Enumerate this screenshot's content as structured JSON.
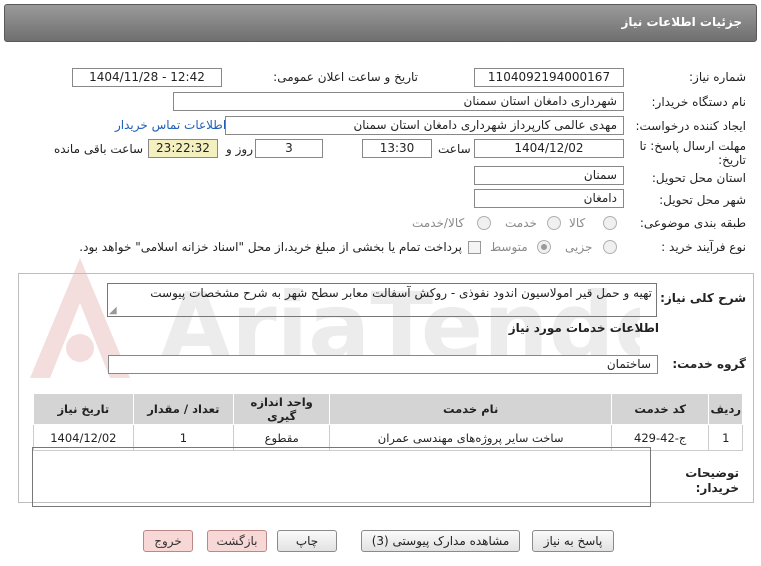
{
  "header": {
    "title": "جزئیات اطلاعات نیاز"
  },
  "form": {
    "need_number_label": "شماره نیاز:",
    "need_number": "1104092194000167",
    "announce_label": "تاریخ و ساعت اعلان عمومی:",
    "announce_value": "1404/11/28 - 12:42",
    "buyer_org_label": "نام دستگاه خریدار:",
    "buyer_org": "شهرداری دامغان استان سمنان",
    "creator_label": "ایجاد کننده درخواست:",
    "creator": "مهدی عالمی کارپرداز شهرداری دامغان استان سمنان",
    "contact_link": "اطلاعات تماس خریدار",
    "deadline_label_1": "مهلت ارسال پاسخ: تا",
    "deadline_label_2": "تاریخ:",
    "deadline_date": "1404/12/02",
    "time_label": "ساعت",
    "deadline_time": "13:30",
    "days": "3",
    "days_label": "روز و",
    "remaining_time": "23:22:32",
    "remaining_label": "ساعت باقی مانده",
    "province_label": "استان محل تحویل:",
    "province": "سمنان",
    "city_label": "شهر محل تحویل:",
    "city": "دامغان",
    "category_label": "طبقه بندی موضوعی:",
    "category_options": [
      "کالا",
      "خدمت",
      "کالا/خدمت"
    ],
    "process_label": "نوع فرآیند خرید :",
    "process_options": [
      "جزیی",
      "متوسط"
    ],
    "payment_note": "پرداخت تمام یا بخشی از مبلغ خرید،از محل \"اسناد خزانه اسلامی\" خواهد بود."
  },
  "summary": {
    "label": "شرح کلی نیاز:",
    "text": "تهیه و حمل قیر امولاسیون اندود نفوذی -  روکش آسفالت معابر سطح شهر به شرح مشخصات پیوست"
  },
  "services": {
    "heading": "اطلاعات خدمات مورد نیاز",
    "group_label": "گروه خدمت:",
    "group_value": "ساختمان",
    "columns": [
      "ردیف",
      "کد خدمت",
      "نام خدمت",
      "واحد اندازه گیری",
      "تعداد / مقدار",
      "تاریخ نیاز"
    ],
    "rows": [
      {
        "row": "1",
        "code": "ج-42-429",
        "name": "ساخت سایر پروژه‌های مهندسی عمران",
        "unit": "مقطوع",
        "qty": "1",
        "date": "1404/12/02"
      }
    ]
  },
  "notes": {
    "label_1": "توضیحات",
    "label_2": "خریدار:"
  },
  "buttons": {
    "reply": "پاسخ به نیاز",
    "attachments": "مشاهده مدارک پیوستی (3)",
    "print": "چاپ",
    "back": "بازگشت",
    "exit": "خروج"
  },
  "watermark": {
    "text": "AriaTender.net"
  }
}
